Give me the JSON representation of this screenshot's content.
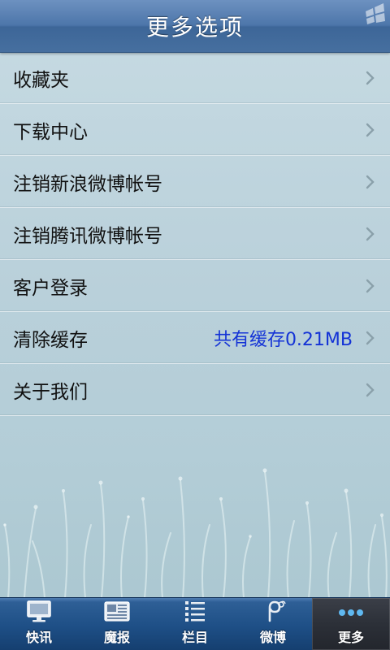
{
  "header": {
    "title": "更多选项"
  },
  "menu": {
    "items": [
      {
        "label": "收藏夹",
        "value": ""
      },
      {
        "label": "下载中心",
        "value": ""
      },
      {
        "label": "注销新浪微博帐号",
        "value": ""
      },
      {
        "label": "注销腾讯微博帐号",
        "value": ""
      },
      {
        "label": "客户登录",
        "value": ""
      },
      {
        "label": "清除缓存",
        "value": "共有缓存0.21MB"
      },
      {
        "label": "关于我们",
        "value": ""
      }
    ]
  },
  "tabbar": {
    "tabs": [
      {
        "label": "快讯",
        "icon": "monitor-icon"
      },
      {
        "label": "魔报",
        "icon": "newspaper-icon"
      },
      {
        "label": "栏目",
        "icon": "list-icon"
      },
      {
        "label": "微博",
        "icon": "weibo-icon"
      },
      {
        "label": "更多",
        "icon": "more-dots-icon"
      }
    ],
    "active_tab": "更多"
  },
  "colors": {
    "header_blue": "#4d76aa",
    "value_blue": "#1433d6",
    "tabbar_blue": "#1e4f86",
    "active_tab": "#2c3038"
  }
}
